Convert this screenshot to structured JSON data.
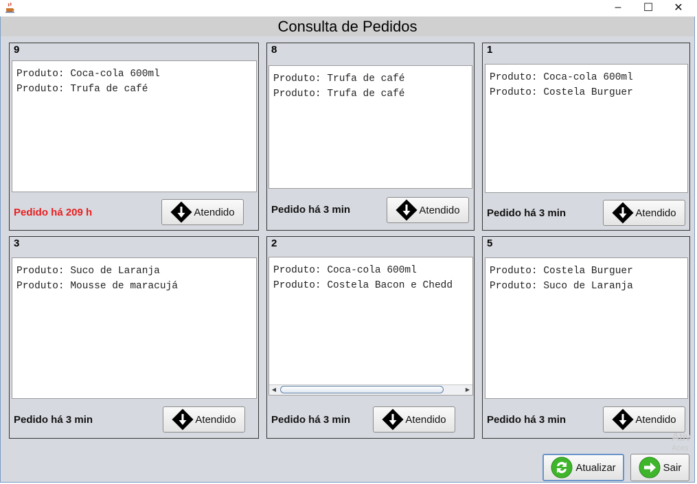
{
  "window": {
    "minimize_glyph": "–",
    "maximize_glyph": "☐",
    "close_glyph": "✕",
    "app_icon": "java-cup-icon"
  },
  "header": {
    "title": "Consulta de Pedidos"
  },
  "orders": [
    {
      "number": "9",
      "items": [
        "Produto: Coca-cola 600ml",
        "Produto: Trufa de café"
      ],
      "status": "Pedido há 209 h",
      "late": true,
      "button": "Atendido"
    },
    {
      "number": "8",
      "items": [
        "Produto: Trufa de café",
        "Produto: Trufa de café"
      ],
      "status": "Pedido há 3 min",
      "late": false,
      "button": "Atendido"
    },
    {
      "number": "1",
      "items": [
        "Produto: Coca-cola 600ml",
        "Produto: Costela Burguer"
      ],
      "status": "Pedido há 3 min",
      "late": false,
      "button": "Atendido"
    },
    {
      "number": "3",
      "items": [
        "Produto: Suco de Laranja",
        "Produto: Mousse de maracujá"
      ],
      "status": "Pedido há 3 min",
      "late": false,
      "button": "Atendido"
    },
    {
      "number": "2",
      "items": [
        "Produto: Coca-cola 600ml",
        "Produto: Costela Bacon e Chedd"
      ],
      "status": "Pedido há 3 min",
      "late": false,
      "button": "Atendido"
    },
    {
      "number": "5",
      "items": [
        "Produto: Costela Burguer",
        "Produto: Suco de Laranja"
      ],
      "status": "Pedido há 3 min",
      "late": false,
      "button": "Atendido"
    }
  ],
  "footer": {
    "refresh_label": "Atualizar",
    "exit_label": "Sair"
  },
  "watermark": {
    "line1": "Ativ",
    "line2": "Aces"
  },
  "colors": {
    "panel_bg": "#d6d9df",
    "late_status": "#e81e1e",
    "icon_green": "#3fb52c",
    "icon_black": "#000000"
  }
}
